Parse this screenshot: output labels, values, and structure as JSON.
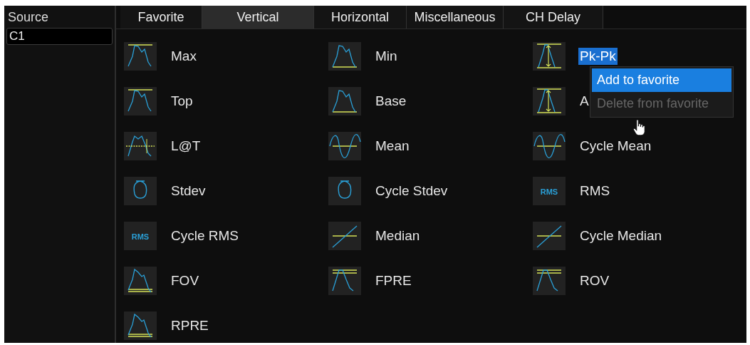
{
  "source_panel": {
    "label": "Source",
    "value": "C1"
  },
  "tabs": [
    {
      "label": "Favorite",
      "selected": false
    },
    {
      "label": "Vertical",
      "selected": true
    },
    {
      "label": "Horizontal",
      "selected": false
    },
    {
      "label": "Miscellaneous",
      "selected": false
    },
    {
      "label": "CH Delay",
      "selected": false
    }
  ],
  "measurements": [
    {
      "label": "Max",
      "kind": "line-top",
      "selected": false
    },
    {
      "label": "Min",
      "kind": "line-bottom",
      "selected": false
    },
    {
      "label": "Pk-Pk",
      "kind": "span",
      "selected": true
    },
    {
      "label": "Top",
      "kind": "line-top",
      "selected": false
    },
    {
      "label": "Base",
      "kind": "line-bottom",
      "selected": false
    },
    {
      "label": "A",
      "kind": "span",
      "selected": false
    },
    {
      "label": "L@T",
      "kind": "cross",
      "selected": false
    },
    {
      "label": "Mean",
      "kind": "sine",
      "selected": false
    },
    {
      "label": "Cycle Mean",
      "kind": "sine",
      "selected": false
    },
    {
      "label": "Stdev",
      "kind": "sigma",
      "selected": false
    },
    {
      "label": "Cycle Stdev",
      "kind": "sigma",
      "selected": false
    },
    {
      "label": "RMS",
      "kind": "text",
      "icon_text": "RMS",
      "selected": false
    },
    {
      "label": "Cycle RMS",
      "kind": "text",
      "icon_text": "RMS",
      "selected": false
    },
    {
      "label": "Median",
      "kind": "ramp",
      "selected": false
    },
    {
      "label": "Cycle Median",
      "kind": "ramp",
      "selected": false
    },
    {
      "label": "FOV",
      "kind": "double-bottom",
      "selected": false
    },
    {
      "label": "FPRE",
      "kind": "double-top",
      "selected": false
    },
    {
      "label": "ROV",
      "kind": "double-top",
      "selected": false
    },
    {
      "label": "RPRE",
      "kind": "double-bottom",
      "selected": false
    }
  ],
  "context_menu": {
    "items": [
      {
        "label": "Add to favorite",
        "selected": true,
        "disabled": false
      },
      {
        "label": "Delete from favorite",
        "selected": false,
        "disabled": true
      }
    ]
  }
}
